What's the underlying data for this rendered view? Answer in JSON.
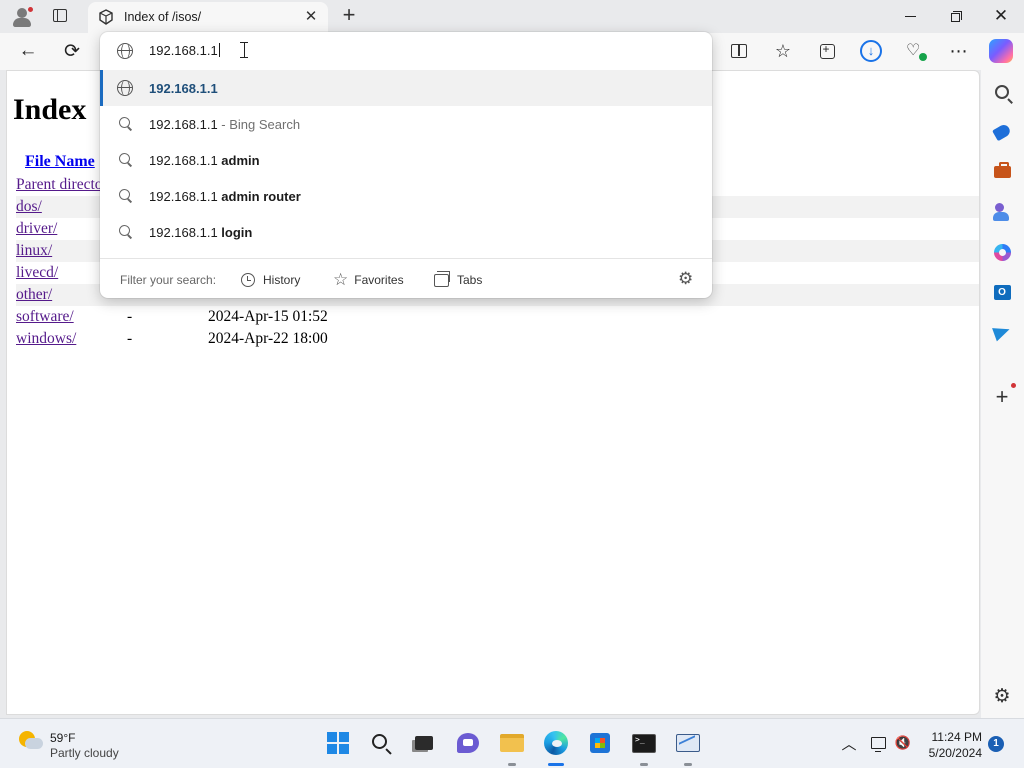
{
  "browser": {
    "tab": {
      "title": "Index of /isos/",
      "close_glyph": "✕"
    },
    "new_tab_glyph": "+",
    "window": {
      "close_glyph": "✕"
    },
    "toolbar": {
      "back_glyph": "←",
      "refresh_glyph": "⟳",
      "favorites_glyph": "☆",
      "more_glyph": "⋯",
      "download_glyph": "↓",
      "heart_glyph": "♡"
    }
  },
  "omnibox": {
    "input_value": "192.168.1.1",
    "suggestions": [
      {
        "type": "url",
        "text": "192.168.1.1"
      },
      {
        "type": "search",
        "prefix": "192.168.1.1",
        "muted": " - Bing Search",
        "bold": ""
      },
      {
        "type": "search",
        "prefix": "192.168.1.1 ",
        "muted": "",
        "bold": "admin"
      },
      {
        "type": "search",
        "prefix": "192.168.1.1 ",
        "muted": "",
        "bold": "admin router"
      },
      {
        "type": "search",
        "prefix": "192.168.1.1 ",
        "muted": "",
        "bold": "login"
      }
    ],
    "footer": {
      "filter_label": "Filter your search:",
      "history_label": "History",
      "favorites_label": "Favorites",
      "tabs_label": "Tabs",
      "gear_glyph": "⚙"
    }
  },
  "page": {
    "heading": "Index",
    "header_file_name": "File Name",
    "rows": [
      {
        "name": "Parent directo",
        "size": "",
        "date": ""
      },
      {
        "name": "dos/",
        "size": "",
        "date": ""
      },
      {
        "name": "driver/",
        "size": "",
        "date": ""
      },
      {
        "name": "linux/",
        "size": "",
        "date": ""
      },
      {
        "name": "livecd/",
        "size": "",
        "date": ""
      },
      {
        "name": "other/",
        "size": "",
        "date": ""
      },
      {
        "name": "software/",
        "size": "-",
        "date": "2024-Apr-15 01:52"
      },
      {
        "name": "windows/",
        "size": "-",
        "date": "2024-Apr-22 18:00"
      }
    ]
  },
  "sidebar": {
    "add_glyph": "+",
    "settings_glyph": "⚙",
    "outlook_letter": "O"
  },
  "taskbar": {
    "weather": {
      "temp": "59°F",
      "condition": "Partly cloudy"
    },
    "chevron_glyph": "︿",
    "volume_glyph": "🔇",
    "terminal_prompt": ">_",
    "clock": {
      "time": "11:24 PM",
      "date": "5/20/2024"
    },
    "notification_count": "1"
  },
  "colors": {
    "accent": "#1b6bc0",
    "link": "#0000ee",
    "visited_link": "#551a8b",
    "notification_dot": "#d13438"
  }
}
